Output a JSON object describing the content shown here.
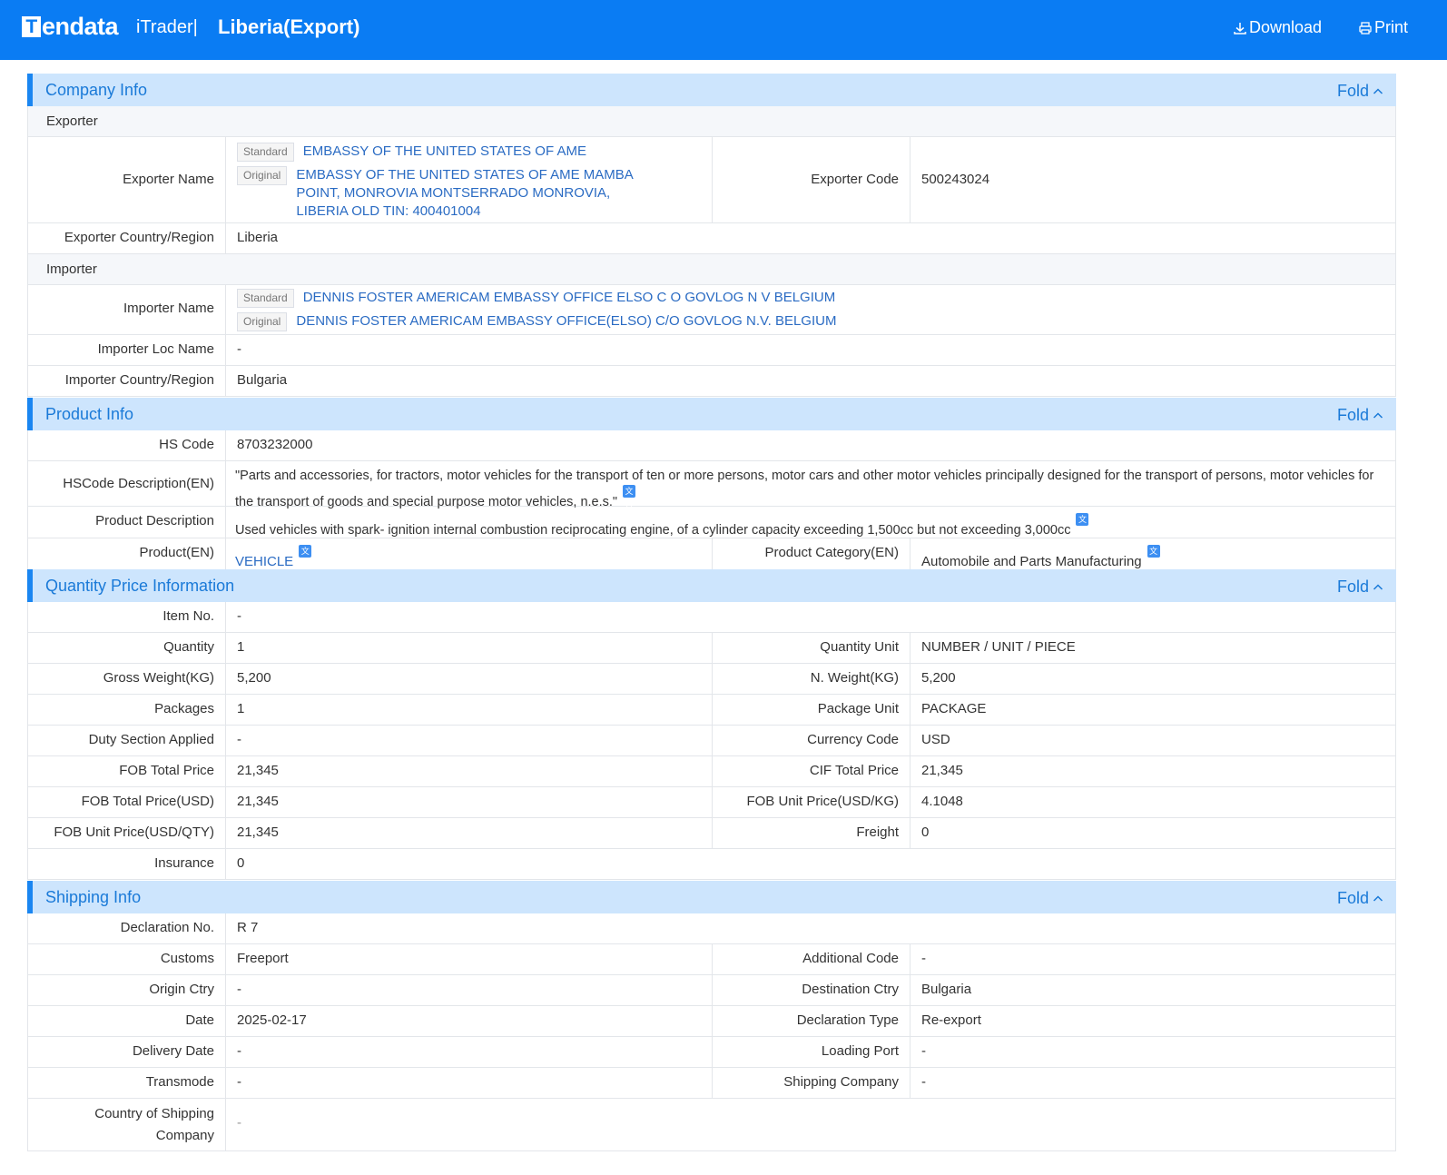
{
  "header": {
    "logo_t": "T",
    "logo_rest": "endata",
    "product": "iTrader|",
    "title": "Liberia(Export)",
    "download_label": "Download",
    "print_label": "Print"
  },
  "fold_label": "Fold",
  "company": {
    "section_title": "Company Info",
    "exporter_heading": "Exporter",
    "exporter_name_label": "Exporter Name",
    "standard_tag": "Standard",
    "original_tag": "Original",
    "exporter_standard": "EMBASSY OF THE UNITED STATES OF AME",
    "exporter_original": "EMBASSY OF THE UNITED STATES OF AME MAMBA POINT, MONROVIA MONTSERRADO MONROVIA, LIBERIA OLD TIN: 400401004",
    "exporter_code_label": "Exporter Code",
    "exporter_code": "500243024",
    "exporter_country_label": "Exporter Country/Region",
    "exporter_country": "Liberia",
    "importer_heading": "Importer",
    "importer_name_label": "Importer Name",
    "importer_standard": "DENNIS FOSTER AMERICAM EMBASSY OFFICE ELSO C O GOVLOG N V BELGIUM",
    "importer_original": "DENNIS FOSTER AMERICAM EMBASSY OFFICE(ELSO) C/O GOVLOG N.V. BELGIUM",
    "importer_loc_label": "Importer  Loc Name",
    "importer_loc": "-",
    "importer_country_label": "Importer Country/Region",
    "importer_country": "Bulgaria"
  },
  "product": {
    "section_title": "Product Info",
    "hs_code_label": "HS Code",
    "hs_code": "8703232000",
    "hs_desc_label": "HSCode Description(EN)",
    "hs_desc": "\"Parts and accessories, for tractors, motor vehicles for the transport of ten or more persons, motor cars and other motor vehicles principally designed for the transport of persons, motor vehicles for the transport of goods and special purpose motor vehicles, n.e.s.\"",
    "product_desc_label": "Product Description",
    "product_desc": "Used vehicles with spark- ignition internal combustion reciprocating engine, of a cylinder capacity exceeding 1,500cc but not exceeding 3,000cc",
    "product_en_label": "Product(EN)",
    "product_en": "VEHICLE",
    "category_label": "Product Category(EN)",
    "category": "Automobile and Parts Manufacturing"
  },
  "quantity": {
    "section_title": "Quantity Price Information",
    "item_no_label": "Item No.",
    "item_no": "-",
    "quantity_label": "Quantity",
    "quantity": "1",
    "quantity_unit_label": "Quantity Unit",
    "quantity_unit": "NUMBER / UNIT / PIECE",
    "gross_label": "Gross Weight(KG)",
    "gross": "5,200",
    "net_label": "N. Weight(KG)",
    "net": "5,200",
    "packages_label": "Packages",
    "packages": "1",
    "package_unit_label": "Package Unit",
    "package_unit": "PACKAGE",
    "duty_label": "Duty Section Applied",
    "duty": "-",
    "currency_label": "Currency Code",
    "currency": "USD",
    "fob_total_label": "FOB Total Price",
    "fob_total": "21,345",
    "cif_total_label": "CIF Total Price",
    "cif_total": "21,345",
    "fob_total_usd_label": "FOB Total Price(USD)",
    "fob_total_usd": "21,345",
    "fob_unit_kg_label": "FOB Unit Price(USD/KG)",
    "fob_unit_kg": "4.1048",
    "fob_unit_qty_label": "FOB Unit Price(USD/QTY)",
    "fob_unit_qty": "21,345",
    "freight_label": "Freight",
    "freight": "0",
    "insurance_label": "Insurance",
    "insurance": "0"
  },
  "shipping": {
    "section_title": "Shipping Info",
    "declaration_no_label": "Declaration No.",
    "declaration_no": "R 7",
    "customs_label": "Customs",
    "customs": "Freeport",
    "additional_code_label": "Additional Code",
    "additional_code": "-",
    "origin_label": "Origin Ctry",
    "origin": "-",
    "destination_label": "Destination Ctry",
    "destination": "Bulgaria",
    "date_label": "Date",
    "date": "2025-02-17",
    "declaration_type_label": "Declaration Type",
    "declaration_type": "Re-export",
    "delivery_label": "Delivery Date",
    "delivery": "-",
    "loading_port_label": "Loading Port",
    "loading_port": "-",
    "transmode_label": "Transmode",
    "transmode": "-",
    "shipping_company_label": "Shipping Company",
    "shipping_company": "-",
    "country_shipping_label": "Country of Shipping Company",
    "country_shipping": "-"
  }
}
